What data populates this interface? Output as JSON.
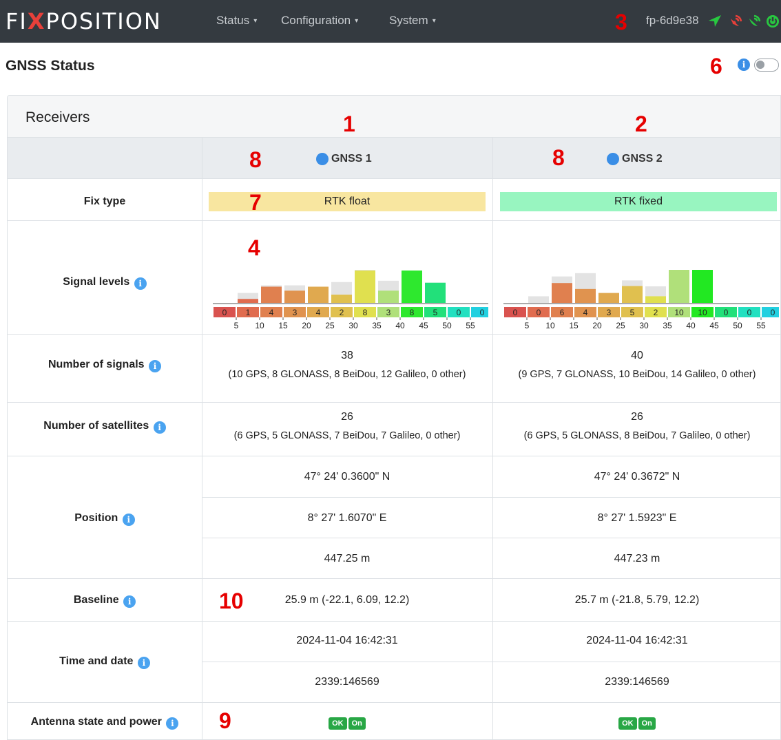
{
  "nav": {
    "brand_left": "FI",
    "brand_x": "X",
    "brand_right": "POSITION",
    "menus": [
      {
        "label": "Status"
      },
      {
        "label": "Configuration"
      },
      {
        "label": "System"
      }
    ],
    "device_name": "fp-6d9e38",
    "caret": "▾"
  },
  "page": {
    "title": "GNSS Status",
    "info_glyph": "i"
  },
  "annotations": {
    "n1": "1",
    "n2": "2",
    "n3": "3",
    "n4": "4",
    "n6": "6",
    "n7": "7",
    "n8a": "8",
    "n8b": "8",
    "n9": "9",
    "n10": "10"
  },
  "receivers": {
    "card_title": "Receivers",
    "rx1": {
      "name": "GNSS 1",
      "fix_type": "RTK float",
      "fix_color": "#f8e6a0",
      "signals_count": "38",
      "signals_detail": "(10 GPS, 8 GLONASS, 8 BeiDou, 12 Galileo, 0 other)",
      "sats_count": "26",
      "sats_detail": "(6 GPS, 5 GLONASS, 7 BeiDou, 7 Galileo, 0 other)",
      "lat": "47° 24' 0.3600\" N",
      "lon": "8° 27' 1.6070\" E",
      "alt": "447.25 m",
      "baseline": "25.9 m (-22.1, 6.09, 12.2)",
      "time": "2024-11-04 16:42:31",
      "gps_time": "2339:146569",
      "antenna_state": "OK",
      "antenna_power": "On"
    },
    "rx2": {
      "name": "GNSS 2",
      "fix_type": "RTK fixed",
      "fix_color": "#98f5c0",
      "signals_count": "40",
      "signals_detail": "(9 GPS, 7 GLONASS, 10 BeiDou, 14 Galileo, 0 other)",
      "sats_count": "26",
      "sats_detail": "(6 GPS, 5 GLONASS, 8 BeiDou, 7 Galileo, 0 other)",
      "lat": "47° 24' 0.3672\" N",
      "lon": "8° 27' 1.5923\" E",
      "alt": "447.23 m",
      "baseline": "25.7 m (-21.8, 5.79, 12.2)",
      "time": "2024-11-04 16:42:31",
      "gps_time": "2339:146569",
      "antenna_state": "OK",
      "antenna_power": "On"
    },
    "labels": {
      "fix_type": "Fix type",
      "signal_levels": "Signal levels",
      "num_signals": "Number of signals",
      "num_sats": "Number of satellites",
      "position": "Position",
      "baseline": "Baseline",
      "time_date": "Time and date",
      "antenna": "Antenna state and power"
    }
  },
  "chart_data": [
    {
      "type": "bar",
      "title": "GNSS 1 signal levels",
      "bins": [
        "0-5",
        "5-10",
        "10-15",
        "15-20",
        "20-25",
        "25-30",
        "30-35",
        "35-40",
        "40-45",
        "45-50",
        "50-55",
        "55+"
      ],
      "x_tick_labels": [
        "5",
        "10",
        "15",
        "20",
        "25",
        "30",
        "35",
        "40",
        "45",
        "50",
        "55"
      ],
      "counts": [
        0,
        1,
        4,
        3,
        4,
        2,
        8,
        3,
        8,
        5,
        0,
        0
      ],
      "bin_colors": [
        "#d9534f",
        "#e06c4f",
        "#e0804f",
        "#e0934f",
        "#e0a94f",
        "#e0c04f",
        "#e0e04f",
        "#b0e07a",
        "#2ee82e",
        "#22e07a",
        "#22e0c0",
        "#22d0e0"
      ],
      "bar_heights_relative": [
        0.0,
        0.12,
        0.49,
        0.37,
        0.49,
        0.25,
        0.98,
        0.37,
        0.98,
        0.61,
        0.0,
        0.0
      ],
      "ghost_heights_relative": [
        0.0,
        0.3,
        0.53,
        0.53,
        0.49,
        0.63,
        1.0,
        0.67,
        0.98,
        0.61,
        0.0,
        0.0
      ]
    },
    {
      "type": "bar",
      "title": "GNSS 2 signal levels",
      "bins": [
        "0-5",
        "5-10",
        "10-15",
        "15-20",
        "20-25",
        "25-30",
        "30-35",
        "35-40",
        "40-45",
        "45-50",
        "50-55",
        "55+"
      ],
      "x_tick_labels": [
        "5",
        "10",
        "15",
        "20",
        "25",
        "30",
        "35",
        "40",
        "45",
        "50",
        "55"
      ],
      "counts": [
        0,
        0,
        6,
        4,
        3,
        5,
        2,
        10,
        10,
        0,
        0,
        0
      ],
      "bin_colors": [
        "#d9534f",
        "#e06c4f",
        "#e0804f",
        "#e0934f",
        "#e0a94f",
        "#e0c04f",
        "#e0e04f",
        "#b0e07a",
        "#22e822",
        "#22e07a",
        "#22e0c0",
        "#22d0e0"
      ],
      "bar_heights_relative": [
        0.0,
        0.0,
        0.6,
        0.42,
        0.3,
        0.51,
        0.2,
        1.0,
        1.0,
        0.0,
        0.0,
        0.0
      ],
      "ghost_heights_relative": [
        0.0,
        0.2,
        0.8,
        0.9,
        0.3,
        0.68,
        0.5,
        1.0,
        1.0,
        0.0,
        0.0,
        0.0
      ]
    }
  ]
}
